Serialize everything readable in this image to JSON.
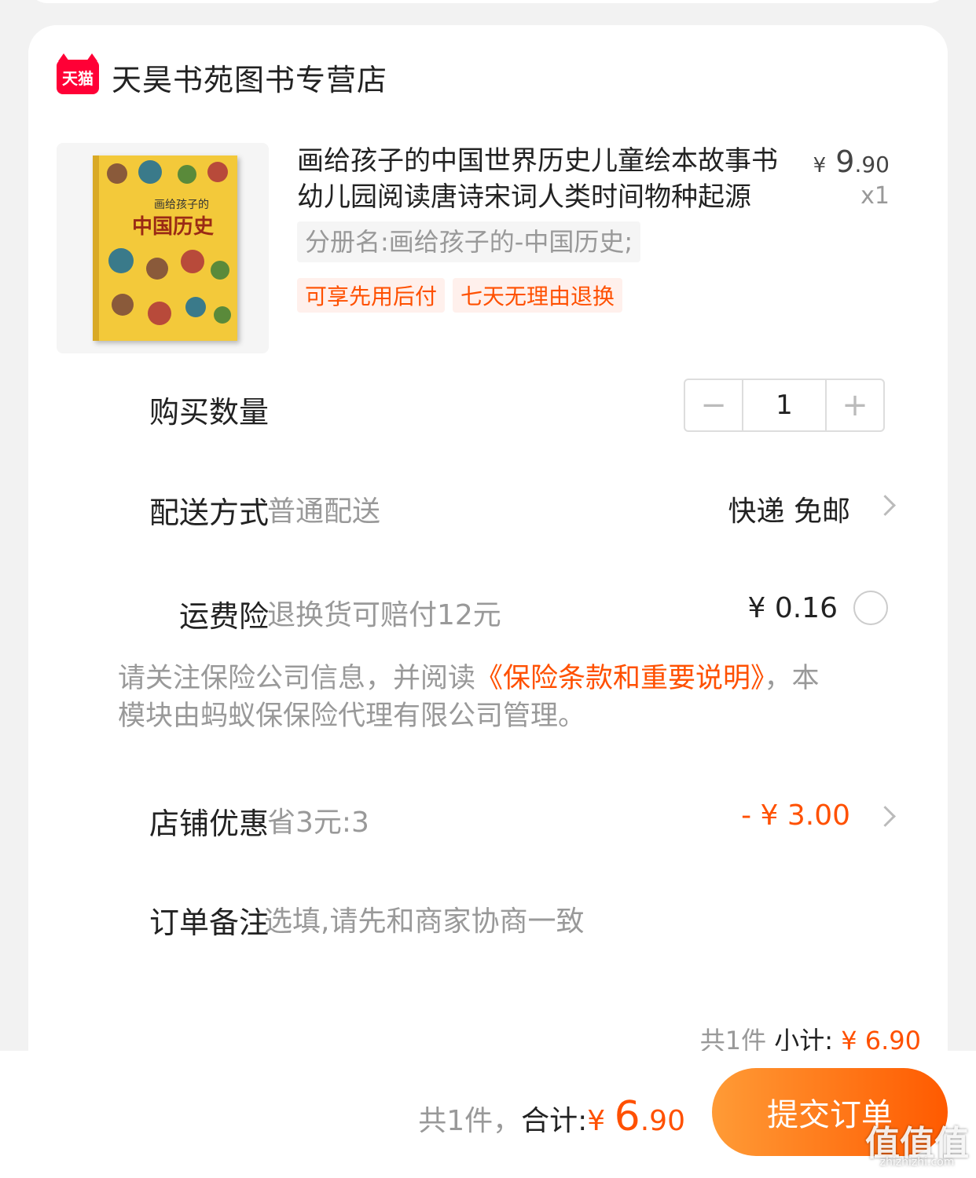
{
  "shop": {
    "logo_text": "天猫",
    "name": "天昊书苑图书专营店"
  },
  "product": {
    "title": "画给孩子的中国世界历史儿童绘本故事书幼儿园阅读唐诗宋词人类时间物种起源",
    "price_symbol": "¥",
    "price_int": "9",
    "price_dec": ".90",
    "quantity": "x1",
    "variant": "分册名:画给孩子的-中国历史;",
    "tags": [
      "可享先用后付",
      "七天无理由退换"
    ],
    "cover_subtitle": "画给孩子的",
    "cover_title": "中国历史"
  },
  "quantity_row": {
    "label": "购买数量",
    "value": "1",
    "minus": "−",
    "plus": "+"
  },
  "shipping_row": {
    "label": "配送方式",
    "desc": "普通配送",
    "value": "快递 免邮"
  },
  "insurance_row": {
    "label": "运费险",
    "desc": "退换货可赔付12元",
    "value": "¥ 0.16"
  },
  "insurance_note": {
    "prefix": "请关注保险公司信息，并阅读",
    "link": "《保险条款和重要说明》",
    "suffix": "，本模块由蚂蚁保保险代理有限公司管理。"
  },
  "discount_row": {
    "label": "店铺优惠",
    "desc": "省3元:3",
    "value": "- ¥ 3.00"
  },
  "note_row": {
    "label": "订单备注",
    "placeholder": "选填,请先和商家协商一致"
  },
  "subtotal": {
    "count": "共1件",
    "label": "小计:",
    "amount": "¥ 6.90"
  },
  "footer": {
    "count": "共1件，",
    "label": "合计:",
    "symbol": "¥ ",
    "amount_int": "6",
    "amount_dec": ".90",
    "submit": "提交订单"
  },
  "watermark": {
    "text": "值值值",
    "site": "zhizhizhi.com"
  },
  "colors": {
    "accent": "#ff5000",
    "tmall": "#ff0036"
  }
}
